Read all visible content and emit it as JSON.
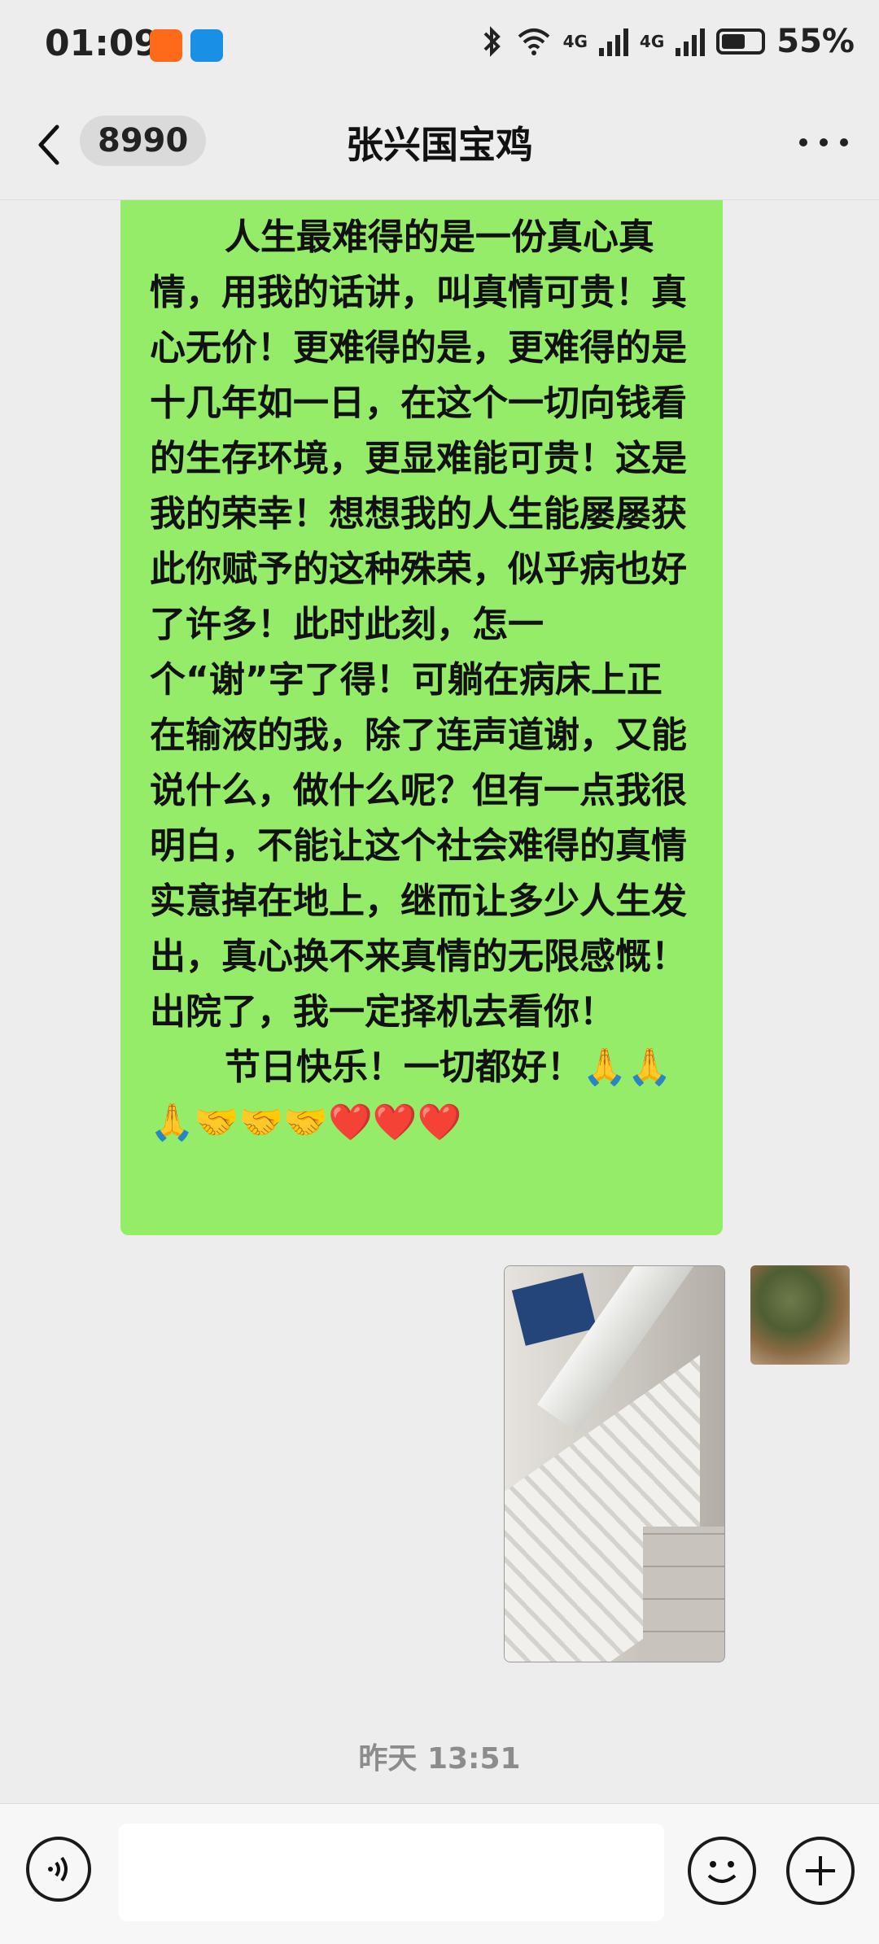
{
  "status_bar": {
    "time": "01:09",
    "network": "4G",
    "battery": "55%"
  },
  "header": {
    "back_icon": "chevron-left-icon",
    "unread_count": "8990",
    "title": "张兴国宝鸡",
    "more_icon": "more-dots-icon"
  },
  "messages": [
    {
      "type": "text",
      "sender": "self",
      "text": "      人生最难得的是一份真心真情，用我的话讲，叫真情可贵！真心无价！更难得的是，更难得的是十几年如一日，在这个一切向钱看的生存环境，更显难能可贵！这是我的荣幸！想想我的人生能屡屡获此你赋予的这种殊荣，似乎病也好了许多！此时此刻，怎一个“谢”字了得！可躺在病床上正在输液的我，除了连声道谢，又能说什么，做什么呢？但有一点我很明白，不能让这个社会难得的真情实意掉在地上，继而让多少人生发出，真心换不来真情的无限感慨！出院了，我一定择机去看你！\n      节日快乐！一切都好！🙏🙏🙏🤝🤝🤝❤️❤️❤️"
    },
    {
      "type": "image",
      "sender": "other",
      "avatar_icon": "contact-avatar"
    }
  ],
  "timestamp": "昨天 13:51",
  "input_bar": {
    "voice_icon": "voice-icon",
    "input_value": "",
    "emoji_icon": "emoji-icon",
    "plus_icon": "plus-icon"
  }
}
